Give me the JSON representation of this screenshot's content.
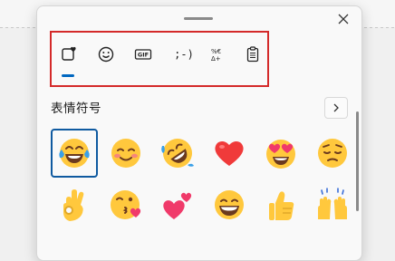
{
  "picker": {
    "toolbar_tabs": [
      {
        "icon": "recent-emoji-heart-icon",
        "selected": true
      },
      {
        "icon": "smiley-icon"
      },
      {
        "icon": "gif-icon",
        "label": "GIF"
      },
      {
        "icon": "kaomoji-icon",
        "label": ";-)"
      },
      {
        "icon": "symbols-icon",
        "label": "%€ Δ+"
      },
      {
        "icon": "clipboard-icon"
      }
    ],
    "section_title": "表情符号",
    "emojis": [
      "face-with-tears-of-joy",
      "smiling-face-with-blush",
      "rolling-on-the-floor-laughing",
      "red-heart",
      "smiling-face-with-heart-eyes",
      "pensive-face",
      "ok-hand",
      "face-blowing-a-kiss",
      "two-hearts",
      "grinning-face-with-big-eyes",
      "thumbs-up",
      "raising-hands"
    ],
    "colors": {
      "accent": "#0067c0",
      "highlight_box": "#d42a2a",
      "emoji_yellow": "#ffc83d",
      "heart_red": "#f03a3a"
    }
  }
}
